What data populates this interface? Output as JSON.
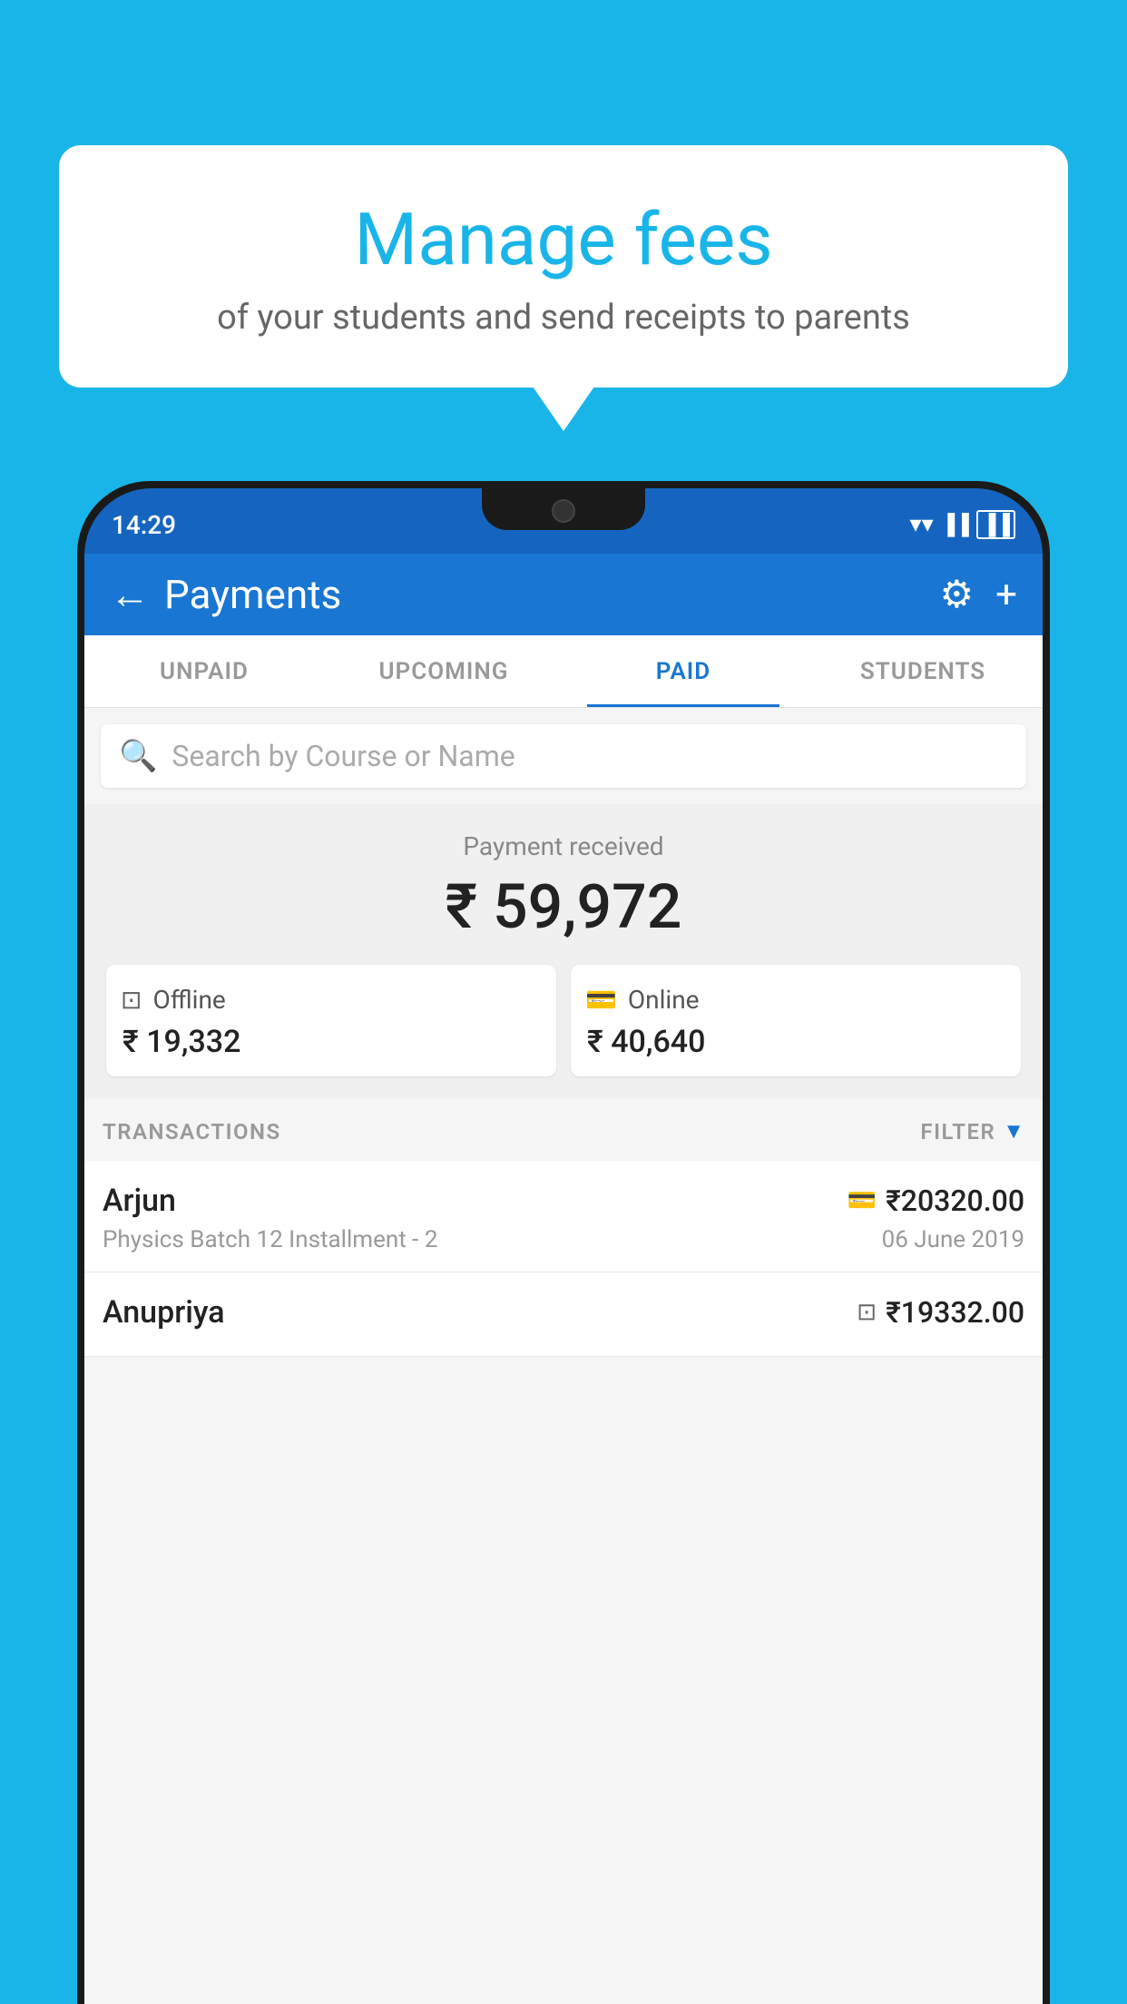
{
  "background_color": "#1ab5e8",
  "speech_bubble": {
    "title": "Manage fees",
    "subtitle": "of your students and send receipts to parents"
  },
  "status_bar": {
    "time": "14:29",
    "wifi": "▼",
    "signal": "▲",
    "battery": "▐"
  },
  "header": {
    "title": "Payments",
    "back_label": "←",
    "gear_label": "⚙",
    "plus_label": "+"
  },
  "tabs": [
    {
      "label": "UNPAID",
      "active": false
    },
    {
      "label": "UPCOMING",
      "active": false
    },
    {
      "label": "PAID",
      "active": true
    },
    {
      "label": "STUDENTS",
      "active": false
    }
  ],
  "search": {
    "placeholder": "Search by Course or Name"
  },
  "payment_summary": {
    "label": "Payment received",
    "amount": "₹ 59,972",
    "offline": {
      "label": "Offline",
      "amount": "₹ 19,332"
    },
    "online": {
      "label": "Online",
      "amount": "₹ 40,640"
    }
  },
  "transactions_header": {
    "label": "TRANSACTIONS",
    "filter": "FILTER"
  },
  "transactions": [
    {
      "name": "Arjun",
      "course": "Physics Batch 12 Installment - 2",
      "amount": "₹20320.00",
      "date": "06 June 2019",
      "payment_type": "online"
    },
    {
      "name": "Anupriya",
      "course": "",
      "amount": "₹19332.00",
      "date": "",
      "payment_type": "offline"
    }
  ]
}
